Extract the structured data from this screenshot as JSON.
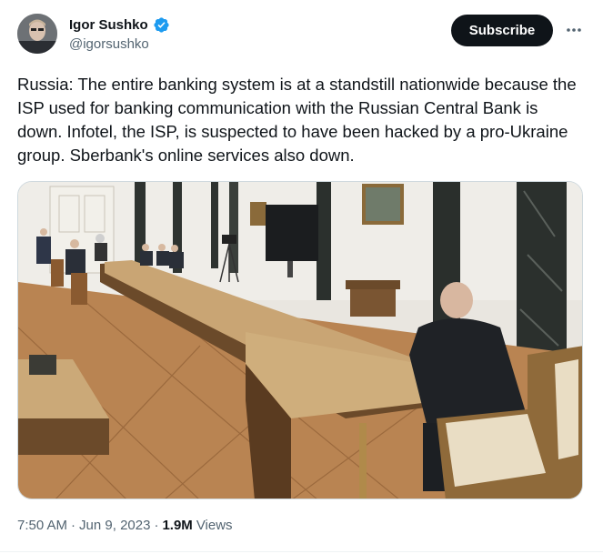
{
  "author": {
    "name": "Igor Sushko",
    "handle": "@igorsushko",
    "verified": true,
    "avatar_icon": "profile-photo"
  },
  "actions": {
    "subscribe_label": "Subscribe",
    "more_icon": "more-dots-icon"
  },
  "tweet": {
    "text": "Russia: The entire banking system is at a standstill nationwide because the ISP used for banking communication with the Russian Central Bank is down. Infotel, the ISP, is suspected to have been hacked by a pro-Ukraine group. Sberbank's online services also down."
  },
  "meta": {
    "time": "7:50 AM",
    "separator": "·",
    "date": "Jun 9, 2023",
    "views_count": "1.9M",
    "views_label": "Views"
  },
  "colors": {
    "verified": "#1d9bf0",
    "subscribe_bg": "#0f1419",
    "secondary_text": "#536471"
  }
}
